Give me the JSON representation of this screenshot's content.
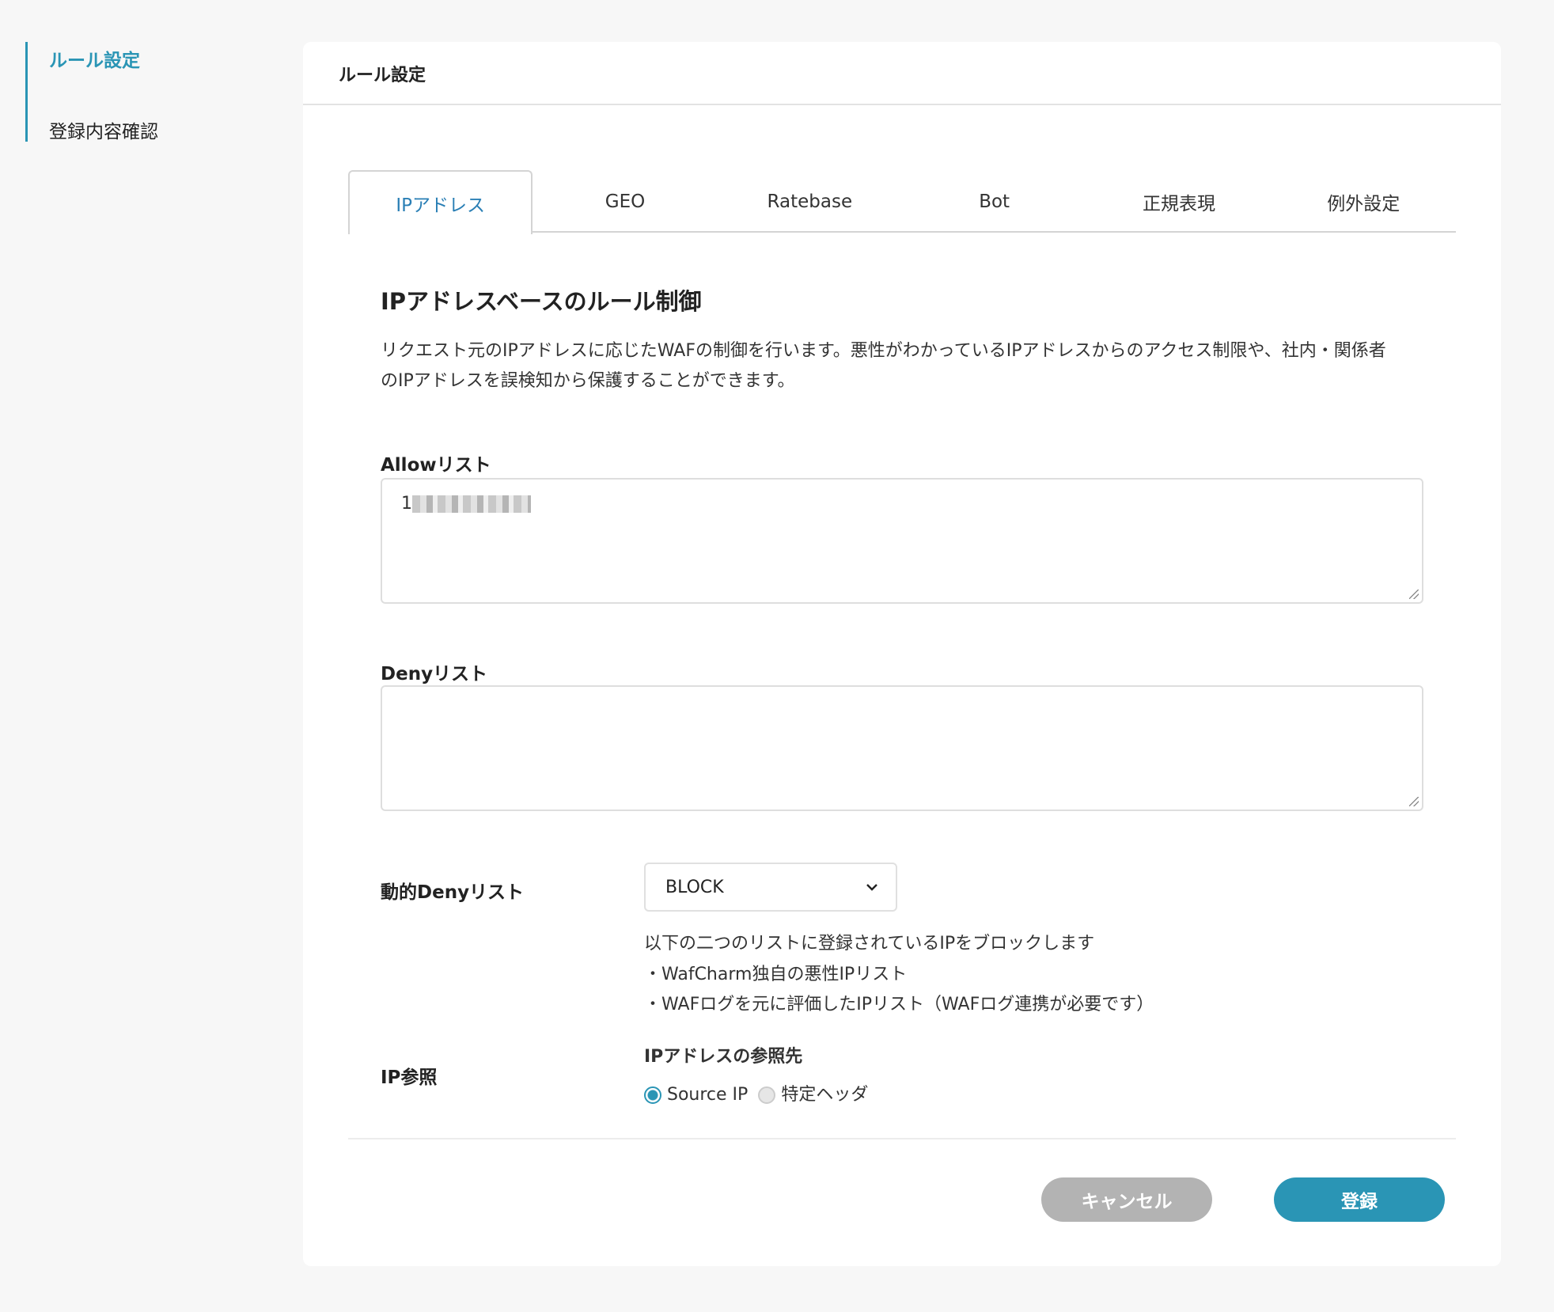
{
  "sidebar": {
    "items": [
      {
        "label": "ルール設定",
        "active": true
      },
      {
        "label": "登録内容確認",
        "active": false
      }
    ]
  },
  "card": {
    "title": "ルール設定"
  },
  "tabs": [
    {
      "label": "IPアドレス",
      "active": true
    },
    {
      "label": "GEO"
    },
    {
      "label": "Ratebase"
    },
    {
      "label": "Bot"
    },
    {
      "label": "正規表現"
    },
    {
      "label": "例外設定"
    }
  ],
  "section": {
    "heading": "IPアドレスベースのルール制御",
    "description": "リクエスト元のIPアドレスに応じたWAFの制御を行います。悪性がわかっているIPアドレスからのアクセス制限や、社内・関係者のIPアドレスを誤検知から保護することができます。"
  },
  "allow": {
    "label": "Allowリスト",
    "value_visible": "1"
  },
  "deny": {
    "label": "Denyリスト",
    "value": ""
  },
  "dynamic_deny": {
    "label": "動的Denyリスト",
    "selected": "BLOCK",
    "help": [
      "以下の二つのリストに登録されているIPをブロックします",
      "・WafCharm独自の悪性IPリスト",
      "・WAFログを元に評価したIPリスト（WAFログ連携が必要です）"
    ]
  },
  "ip_ref": {
    "label": "IP参照",
    "sublabel": "IPアドレスの参照先",
    "options": [
      {
        "label": "Source IP",
        "checked": true
      },
      {
        "label": "特定ヘッダ",
        "checked": false
      }
    ]
  },
  "buttons": {
    "cancel": "キャンセル",
    "submit": "登録"
  },
  "colors": {
    "accent": "#2a95b5",
    "cancel": "#b3b3b3",
    "background": "#f7f7f7"
  }
}
